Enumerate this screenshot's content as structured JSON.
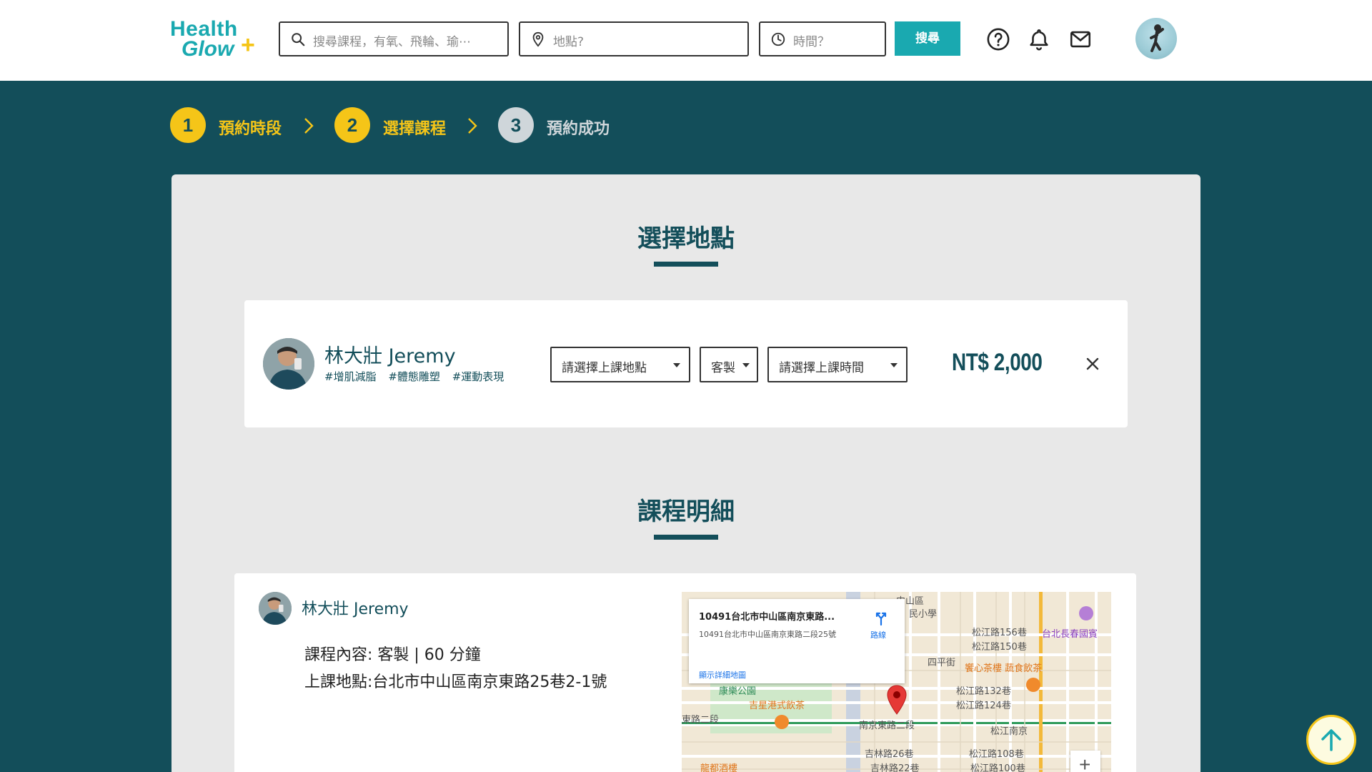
{
  "header": {
    "logo_line1": "Health",
    "logo_line2": "Glow",
    "logo_plus": "+",
    "search_placeholder": "搜尋課程，有氧、飛輪、瑜⋯",
    "location_placeholder": "地點?",
    "time_placeholder": "時間？",
    "search_button": "搜尋",
    "icons": [
      "help-icon",
      "bell-icon",
      "mail-icon"
    ]
  },
  "steps": [
    {
      "num": "1",
      "label": "預約時段",
      "state": "active"
    },
    {
      "num": "2",
      "label": "選擇課程",
      "state": "active"
    },
    {
      "num": "3",
      "label": "預約成功",
      "state": "todo"
    }
  ],
  "section1": {
    "title": "選擇地點",
    "coach_name": "林大壯 Jeremy",
    "tags": [
      "#增肌減脂",
      "#體態雕塑",
      "#運動表現"
    ],
    "location_select": "請選擇上課地點",
    "type_select": "客製",
    "time_select": "請選擇上課時間",
    "price": "NT$ 2,000"
  },
  "section2": {
    "title": "課程明細",
    "coach_name": "林大壯 Jeremy",
    "content_line": "課程內容: 客製 | 60 分鐘",
    "location_line": "上課地點:台北市中山區南京東路25巷2-1號"
  },
  "map": {
    "info_title": "10491台北市中山區南京東路...",
    "info_address": "10491台北市中山區南京東路二段25號",
    "info_link": "顯示詳細地圖",
    "route_label": "路線",
    "labels": {
      "l1": "松江路156巷",
      "l2": "松江路150巷",
      "l3": "四平街",
      "l4": "饗心茶樓 蔬食飲茶",
      "l5": "松江路132巷",
      "l6": "松江路124巷",
      "l7": "康樂公園",
      "l8": "吉星港式飲茶",
      "l9": "南京東路二段",
      "l10": "松江南京",
      "l11": "吉林路26巷",
      "l12": "松江路108巷",
      "l13": "吉林路22巷",
      "l14": "松江路100巷",
      "l15": "台北長春國賓",
      "l16": "龍都酒樓",
      "l17": "東路二段",
      "l18": "中山區",
      "l19": "民小學"
    },
    "zoom_label": "+"
  },
  "colors": {
    "teal_dark": "#134e5a",
    "teal_accent": "#1aa9b0",
    "yellow": "#f5c518"
  }
}
